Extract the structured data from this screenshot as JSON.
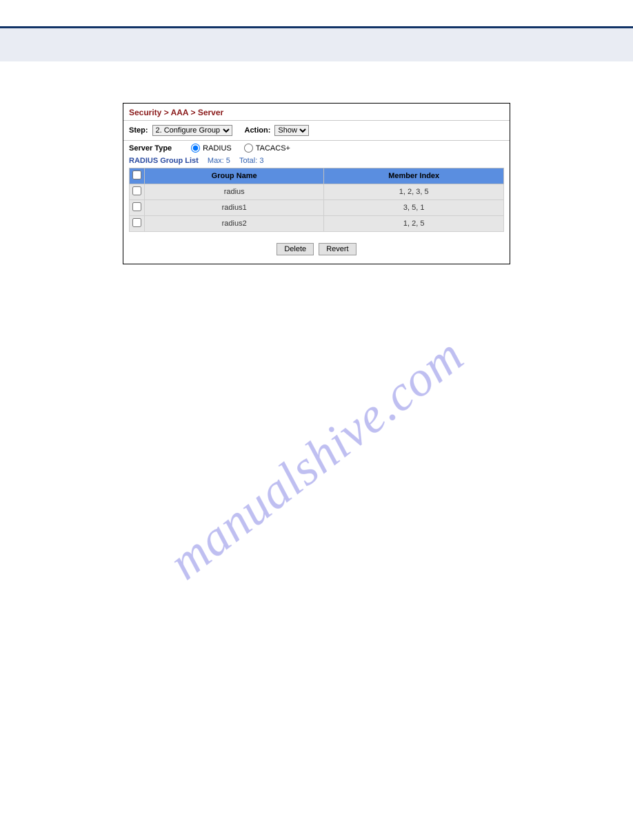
{
  "watermark": "manualshive.com",
  "breadcrumb": "Security > AAA > Server",
  "controls": {
    "step_label": "Step:",
    "step_value": "2. Configure Group",
    "action_label": "Action:",
    "action_value": "Show"
  },
  "server_type": {
    "label": "Server Type",
    "radius": "RADIUS",
    "tacacs": "TACACS+",
    "selected": "RADIUS"
  },
  "list_header": {
    "name": "RADIUS Group List",
    "max_label": "Max: 5",
    "total_label": "Total: 3"
  },
  "columns": {
    "group_name": "Group Name",
    "member_index": "Member Index"
  },
  "rows": [
    {
      "name": "radius",
      "index": "1, 2, 3, 5"
    },
    {
      "name": "radius1",
      "index": "3, 5, 1"
    },
    {
      "name": "radius2",
      "index": "1, 2, 5"
    }
  ],
  "buttons": {
    "delete": "Delete",
    "revert": "Revert"
  }
}
